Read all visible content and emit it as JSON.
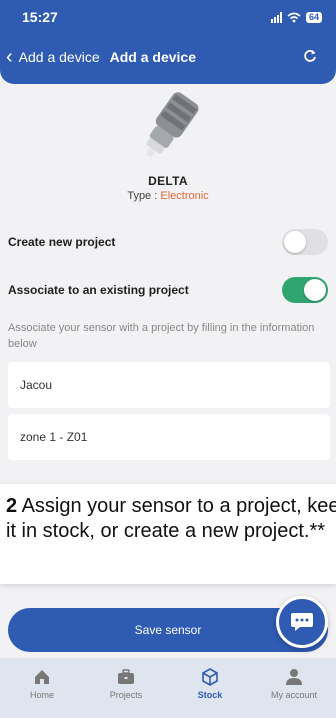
{
  "status_bar": {
    "time": "15:27",
    "battery": "64"
  },
  "header": {
    "back_label": "Add a device",
    "title": "Add a device"
  },
  "device": {
    "name": "DELTA",
    "type_prefix": "Type : ",
    "type_value": "Electronic"
  },
  "toggles": [
    {
      "label": "Create new project",
      "on": false
    },
    {
      "label": "Associate to an existing project",
      "on": true
    }
  ],
  "hint": "Associate your sensor with a project by filling in the information below",
  "fields": {
    "project": "Jacou",
    "zone": "zone 1 - Z01"
  },
  "caption": {
    "number": "2",
    "text": "Assign your sensor to a project, keep it in stock, or create a new project.**"
  },
  "save_button": "Save sensor",
  "tabs": [
    {
      "label": "Home",
      "icon": "home-icon",
      "active": false
    },
    {
      "label": "Projects",
      "icon": "briefcase-icon",
      "active": false
    },
    {
      "label": "Stock",
      "icon": "box-icon",
      "active": true
    },
    {
      "label": "My account",
      "icon": "person-icon",
      "active": false
    }
  ],
  "colors": {
    "primary": "#2f5bb3",
    "toggle_on": "#30a572",
    "accent": "#e46a3c"
  }
}
